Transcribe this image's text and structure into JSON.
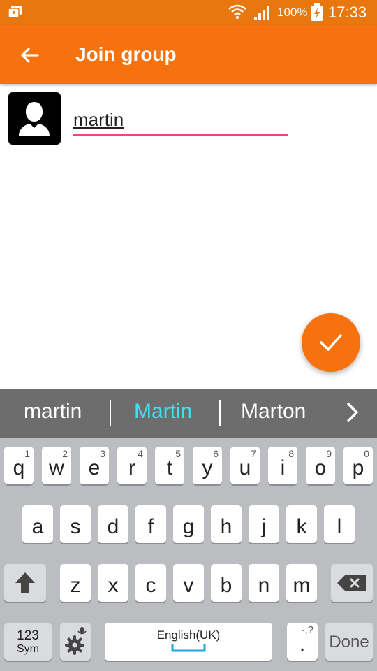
{
  "status_bar": {
    "battery": "100%",
    "time": "17:33"
  },
  "app_bar": {
    "title": "Join group"
  },
  "form": {
    "name_value": "martin"
  },
  "suggestions": [
    "martin",
    "Martin",
    "Marton"
  ],
  "keyboard": {
    "row1": [
      {
        "ch": "q",
        "num": "1"
      },
      {
        "ch": "w",
        "num": "2"
      },
      {
        "ch": "e",
        "num": "3"
      },
      {
        "ch": "r",
        "num": "4"
      },
      {
        "ch": "t",
        "num": "5"
      },
      {
        "ch": "y",
        "num": "6"
      },
      {
        "ch": "u",
        "num": "7"
      },
      {
        "ch": "i",
        "num": "8"
      },
      {
        "ch": "o",
        "num": "9"
      },
      {
        "ch": "p",
        "num": "0"
      }
    ],
    "row2": [
      "a",
      "s",
      "d",
      "f",
      "g",
      "h",
      "j",
      "k",
      "l"
    ],
    "row3": [
      "z",
      "x",
      "c",
      "v",
      "b",
      "n",
      "m"
    ],
    "sym_top": "123",
    "sym_bottom": "Sym",
    "space_label": "English(UK)",
    "punct_top": "·,?",
    "punct_bottom": ".",
    "done": "Done"
  },
  "colors": {
    "accent": "#f5720f",
    "input_underline": "#e84a7c",
    "suggestion_highlight": "#3fe0f0"
  },
  "icons": [
    "notification-icon",
    "wifi-icon",
    "signal-icon",
    "battery-charging-icon",
    "back-arrow-icon",
    "avatar-placeholder-icon",
    "check-icon",
    "chevron-right-icon",
    "shift-icon",
    "backspace-icon",
    "settings-mic-icon"
  ]
}
